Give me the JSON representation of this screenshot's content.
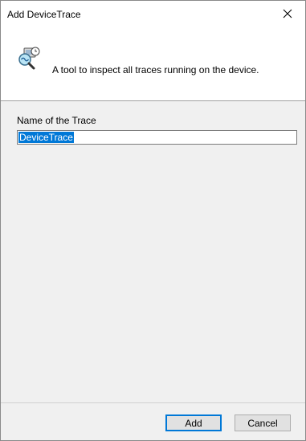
{
  "window": {
    "title": "Add DeviceTrace",
    "close_icon": "close-icon"
  },
  "header": {
    "icon": "device-trace-magnifier-icon",
    "description": "A tool to inspect all traces running on the device."
  },
  "form": {
    "name_label": "Name of the Trace",
    "name_value": "DeviceTrace"
  },
  "footer": {
    "add_label": "Add",
    "cancel_label": "Cancel"
  },
  "colors": {
    "accent": "#0078d7",
    "content_background": "#f0f0f0"
  }
}
